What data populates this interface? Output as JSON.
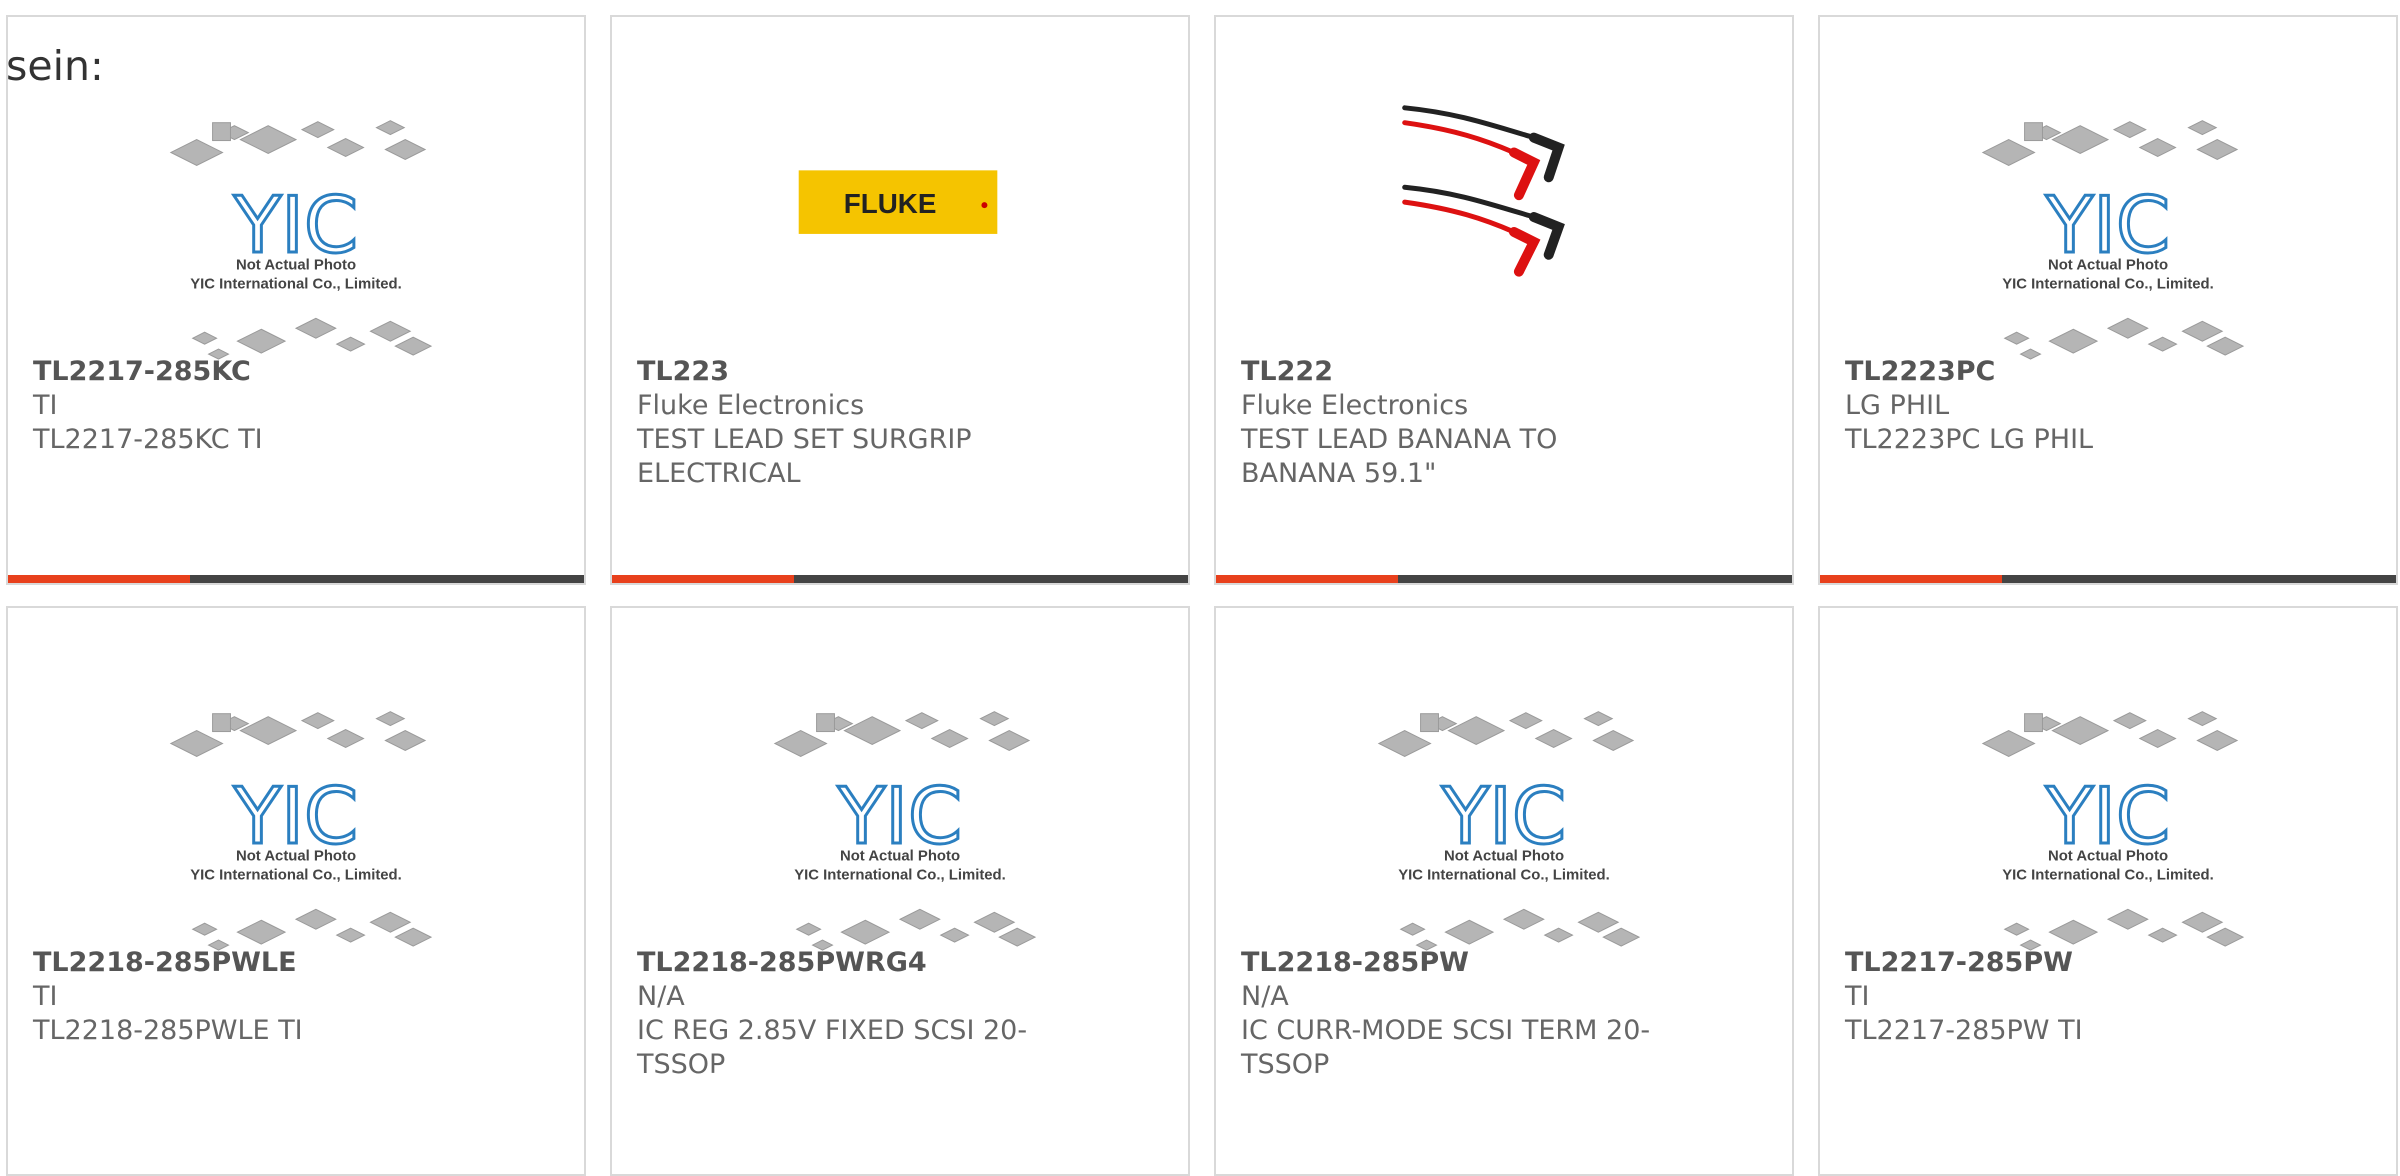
{
  "intro_text": "sein:",
  "placeholder_caption": {
    "line1": "Not Actual Photo",
    "line2": "YIC International Co., Limited.",
    "logo": "YIC"
  },
  "brand_logo_text": "FLUKE",
  "accent_color": "#e8401c",
  "products": [
    {
      "part": "TL2217-285KC",
      "mfr": "TI",
      "desc": "TL2217-285KC TI",
      "image": "placeholder"
    },
    {
      "part": "TL223",
      "mfr": "Fluke Electronics",
      "desc": "TEST LEAD SET SURGRIP ELECTRICAL",
      "image": "fluke-logo"
    },
    {
      "part": "TL222",
      "mfr": "Fluke Electronics",
      "desc": "TEST LEAD BANANA TO BANANA 59.1\"",
      "image": "test-leads"
    },
    {
      "part": "TL2223PC",
      "mfr": "LG PHIL",
      "desc": "TL2223PC LG PHIL",
      "image": "placeholder"
    },
    {
      "part": "TL2218-285PWLE",
      "mfr": "TI",
      "desc": "TL2218-285PWLE TI",
      "image": "placeholder"
    },
    {
      "part": "TL2218-285PWRG4",
      "mfr": "N/A",
      "desc": "IC REG 2.85V FIXED SCSI 20-TSSOP",
      "image": "placeholder"
    },
    {
      "part": "TL2218-285PW",
      "mfr": "N/A",
      "desc": "IC CURR-MODE SCSI TERM 20-TSSOP",
      "image": "placeholder"
    },
    {
      "part": "TL2217-285PW",
      "mfr": "TI",
      "desc": "TL2217-285PW TI",
      "image": "placeholder"
    }
  ]
}
